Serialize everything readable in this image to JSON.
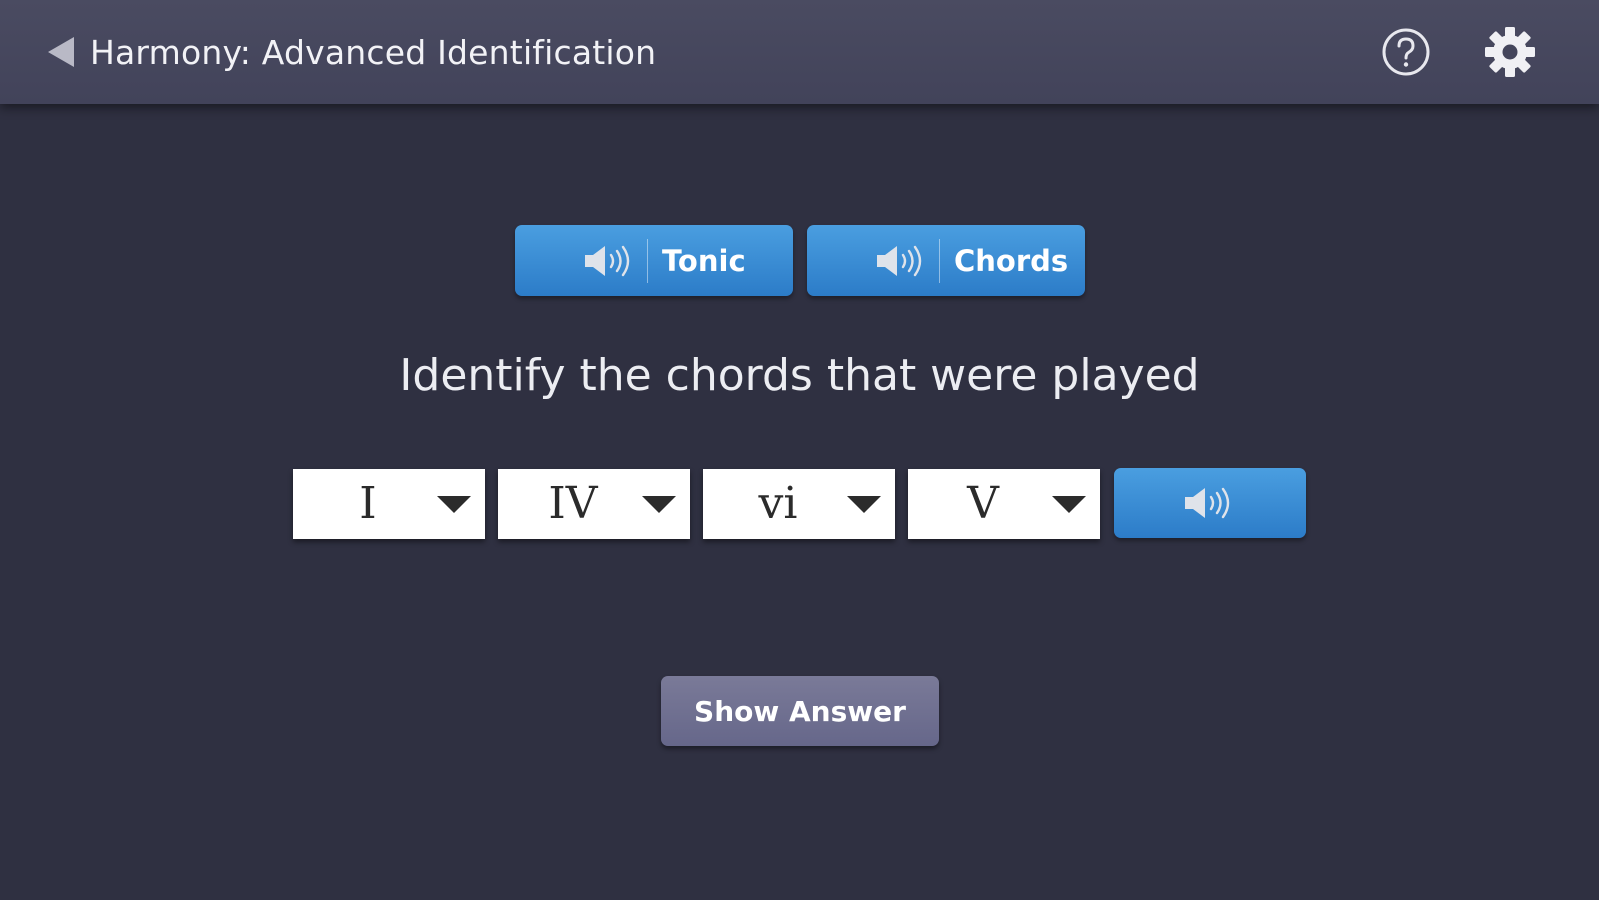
{
  "header": {
    "title": "Harmony: Advanced Identification",
    "back_icon": "back-arrow-icon",
    "help_icon": "help-circle-icon",
    "settings_icon": "gear-icon"
  },
  "playback": {
    "tonic_label": "Tonic",
    "chords_label": "Chords",
    "speaker_icon": "speaker-icon"
  },
  "question": {
    "prompt": "Identify the chords that were played"
  },
  "answers": {
    "selects": [
      {
        "value": "I"
      },
      {
        "value": "IV"
      },
      {
        "value": "vi"
      },
      {
        "value": "V"
      }
    ],
    "play_icon": "speaker-icon"
  },
  "actions": {
    "show_answer_label": "Show Answer"
  },
  "colors": {
    "background": "#2f3041",
    "topbar": "#46475d",
    "accent_blue": "#3a8dd6",
    "secondary_button": "#707093"
  }
}
